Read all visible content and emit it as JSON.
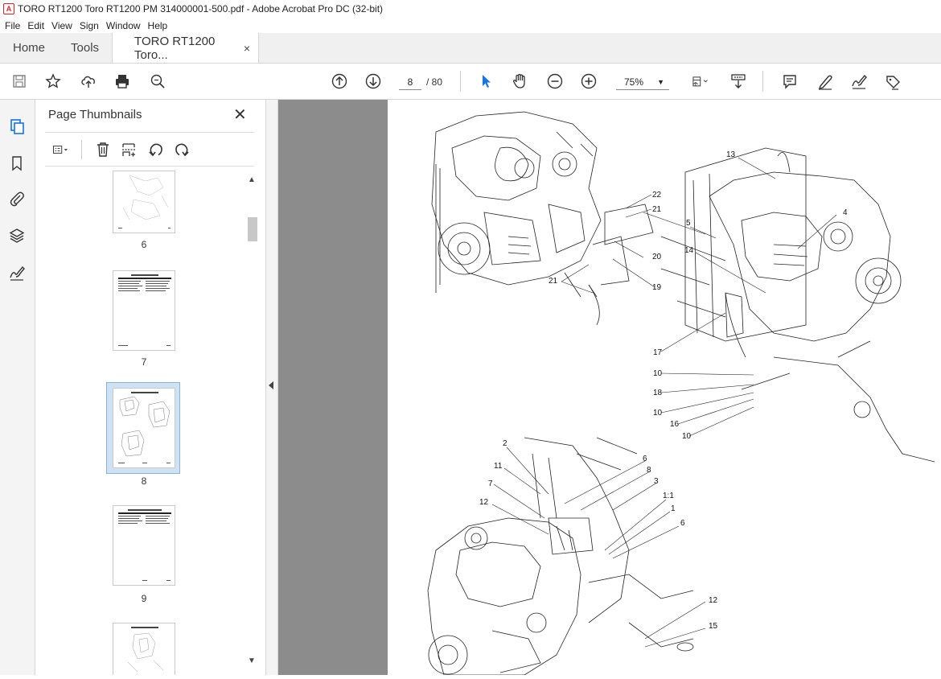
{
  "window": {
    "title": "TORO RT1200 Toro RT1200 PM 314000001-500.pdf - Adobe Acrobat Pro DC (32-bit)",
    "app_icon": "pdf-icon"
  },
  "menu": [
    "File",
    "Edit",
    "View",
    "Sign",
    "Window",
    "Help"
  ],
  "tabs": {
    "home": "Home",
    "tools": "Tools",
    "document": "TORO RT1200 Toro...",
    "close_glyph": "×"
  },
  "toolbar": {
    "current_page": "8",
    "total_pages": "/ 80",
    "zoom": "75%",
    "accent_color": "#1473e6"
  },
  "panel": {
    "title": "Page Thumbnails",
    "close_glyph": "✕",
    "thumbnails": [
      {
        "label": "6"
      },
      {
        "label": "7"
      },
      {
        "label": "8",
        "selected": true
      },
      {
        "label": "9"
      }
    ]
  },
  "drawing": {
    "callouts": [
      "13",
      "22",
      "21",
      "4",
      "5",
      "20",
      "14",
      "21",
      "19",
      "17",
      "10",
      "18",
      "10",
      "16",
      "10",
      "2",
      "6",
      "11",
      "8",
      "7",
      "3",
      "1:1",
      "12",
      "1",
      "6",
      "12",
      "15"
    ]
  }
}
